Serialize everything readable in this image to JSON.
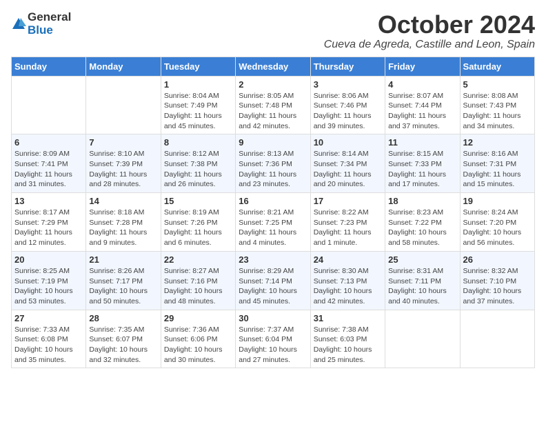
{
  "header": {
    "logo_general": "General",
    "logo_blue": "Blue",
    "month": "October 2024",
    "location": "Cueva de Agreda, Castille and Leon, Spain"
  },
  "days_of_week": [
    "Sunday",
    "Monday",
    "Tuesday",
    "Wednesday",
    "Thursday",
    "Friday",
    "Saturday"
  ],
  "weeks": [
    [
      {
        "day": "",
        "sunrise": "",
        "sunset": "",
        "daylight": ""
      },
      {
        "day": "",
        "sunrise": "",
        "sunset": "",
        "daylight": ""
      },
      {
        "day": "1",
        "sunrise": "Sunrise: 8:04 AM",
        "sunset": "Sunset: 7:49 PM",
        "daylight": "Daylight: 11 hours and 45 minutes."
      },
      {
        "day": "2",
        "sunrise": "Sunrise: 8:05 AM",
        "sunset": "Sunset: 7:48 PM",
        "daylight": "Daylight: 11 hours and 42 minutes."
      },
      {
        "day": "3",
        "sunrise": "Sunrise: 8:06 AM",
        "sunset": "Sunset: 7:46 PM",
        "daylight": "Daylight: 11 hours and 39 minutes."
      },
      {
        "day": "4",
        "sunrise": "Sunrise: 8:07 AM",
        "sunset": "Sunset: 7:44 PM",
        "daylight": "Daylight: 11 hours and 37 minutes."
      },
      {
        "day": "5",
        "sunrise": "Sunrise: 8:08 AM",
        "sunset": "Sunset: 7:43 PM",
        "daylight": "Daylight: 11 hours and 34 minutes."
      }
    ],
    [
      {
        "day": "6",
        "sunrise": "Sunrise: 8:09 AM",
        "sunset": "Sunset: 7:41 PM",
        "daylight": "Daylight: 11 hours and 31 minutes."
      },
      {
        "day": "7",
        "sunrise": "Sunrise: 8:10 AM",
        "sunset": "Sunset: 7:39 PM",
        "daylight": "Daylight: 11 hours and 28 minutes."
      },
      {
        "day": "8",
        "sunrise": "Sunrise: 8:12 AM",
        "sunset": "Sunset: 7:38 PM",
        "daylight": "Daylight: 11 hours and 26 minutes."
      },
      {
        "day": "9",
        "sunrise": "Sunrise: 8:13 AM",
        "sunset": "Sunset: 7:36 PM",
        "daylight": "Daylight: 11 hours and 23 minutes."
      },
      {
        "day": "10",
        "sunrise": "Sunrise: 8:14 AM",
        "sunset": "Sunset: 7:34 PM",
        "daylight": "Daylight: 11 hours and 20 minutes."
      },
      {
        "day": "11",
        "sunrise": "Sunrise: 8:15 AM",
        "sunset": "Sunset: 7:33 PM",
        "daylight": "Daylight: 11 hours and 17 minutes."
      },
      {
        "day": "12",
        "sunrise": "Sunrise: 8:16 AM",
        "sunset": "Sunset: 7:31 PM",
        "daylight": "Daylight: 11 hours and 15 minutes."
      }
    ],
    [
      {
        "day": "13",
        "sunrise": "Sunrise: 8:17 AM",
        "sunset": "Sunset: 7:29 PM",
        "daylight": "Daylight: 11 hours and 12 minutes."
      },
      {
        "day": "14",
        "sunrise": "Sunrise: 8:18 AM",
        "sunset": "Sunset: 7:28 PM",
        "daylight": "Daylight: 11 hours and 9 minutes."
      },
      {
        "day": "15",
        "sunrise": "Sunrise: 8:19 AM",
        "sunset": "Sunset: 7:26 PM",
        "daylight": "Daylight: 11 hours and 6 minutes."
      },
      {
        "day": "16",
        "sunrise": "Sunrise: 8:21 AM",
        "sunset": "Sunset: 7:25 PM",
        "daylight": "Daylight: 11 hours and 4 minutes."
      },
      {
        "day": "17",
        "sunrise": "Sunrise: 8:22 AM",
        "sunset": "Sunset: 7:23 PM",
        "daylight": "Daylight: 11 hours and 1 minute."
      },
      {
        "day": "18",
        "sunrise": "Sunrise: 8:23 AM",
        "sunset": "Sunset: 7:22 PM",
        "daylight": "Daylight: 10 hours and 58 minutes."
      },
      {
        "day": "19",
        "sunrise": "Sunrise: 8:24 AM",
        "sunset": "Sunset: 7:20 PM",
        "daylight": "Daylight: 10 hours and 56 minutes."
      }
    ],
    [
      {
        "day": "20",
        "sunrise": "Sunrise: 8:25 AM",
        "sunset": "Sunset: 7:19 PM",
        "daylight": "Daylight: 10 hours and 53 minutes."
      },
      {
        "day": "21",
        "sunrise": "Sunrise: 8:26 AM",
        "sunset": "Sunset: 7:17 PM",
        "daylight": "Daylight: 10 hours and 50 minutes."
      },
      {
        "day": "22",
        "sunrise": "Sunrise: 8:27 AM",
        "sunset": "Sunset: 7:16 PM",
        "daylight": "Daylight: 10 hours and 48 minutes."
      },
      {
        "day": "23",
        "sunrise": "Sunrise: 8:29 AM",
        "sunset": "Sunset: 7:14 PM",
        "daylight": "Daylight: 10 hours and 45 minutes."
      },
      {
        "day": "24",
        "sunrise": "Sunrise: 8:30 AM",
        "sunset": "Sunset: 7:13 PM",
        "daylight": "Daylight: 10 hours and 42 minutes."
      },
      {
        "day": "25",
        "sunrise": "Sunrise: 8:31 AM",
        "sunset": "Sunset: 7:11 PM",
        "daylight": "Daylight: 10 hours and 40 minutes."
      },
      {
        "day": "26",
        "sunrise": "Sunrise: 8:32 AM",
        "sunset": "Sunset: 7:10 PM",
        "daylight": "Daylight: 10 hours and 37 minutes."
      }
    ],
    [
      {
        "day": "27",
        "sunrise": "Sunrise: 7:33 AM",
        "sunset": "Sunset: 6:08 PM",
        "daylight": "Daylight: 10 hours and 35 minutes."
      },
      {
        "day": "28",
        "sunrise": "Sunrise: 7:35 AM",
        "sunset": "Sunset: 6:07 PM",
        "daylight": "Daylight: 10 hours and 32 minutes."
      },
      {
        "day": "29",
        "sunrise": "Sunrise: 7:36 AM",
        "sunset": "Sunset: 6:06 PM",
        "daylight": "Daylight: 10 hours and 30 minutes."
      },
      {
        "day": "30",
        "sunrise": "Sunrise: 7:37 AM",
        "sunset": "Sunset: 6:04 PM",
        "daylight": "Daylight: 10 hours and 27 minutes."
      },
      {
        "day": "31",
        "sunrise": "Sunrise: 7:38 AM",
        "sunset": "Sunset: 6:03 PM",
        "daylight": "Daylight: 10 hours and 25 minutes."
      },
      {
        "day": "",
        "sunrise": "",
        "sunset": "",
        "daylight": ""
      },
      {
        "day": "",
        "sunrise": "",
        "sunset": "",
        "daylight": ""
      }
    ]
  ]
}
